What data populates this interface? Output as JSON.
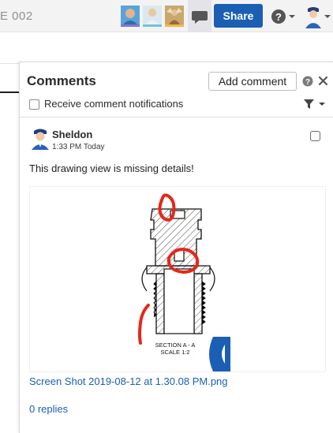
{
  "topbar": {
    "doc_title": "E 002",
    "share_label": "Share",
    "user_colors": [
      "#8a6fd1",
      "#6fc5d8",
      "#f2b84b"
    ]
  },
  "comments_panel": {
    "title": "Comments",
    "add_comment_label": "Add comment",
    "notifications_label": "Receive comment notifications",
    "comment": {
      "author": "Sheldon",
      "time": "1:33 PM Today",
      "body": "This drawing view is missing details!",
      "attachment": {
        "section_label": "SECTION A - A",
        "scale_label": "SCALE 1:2",
        "file_name": "Screen Shot 2019-08-12 at 1.30.08 PM.png"
      },
      "replies": "0 replies"
    }
  },
  "colors": {
    "accent": "#1a5fb4",
    "markup_red": "#e8261a"
  }
}
